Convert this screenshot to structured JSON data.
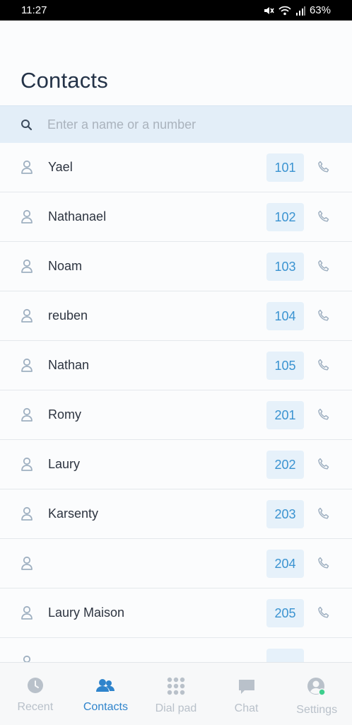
{
  "status_bar": {
    "time": "11:27",
    "battery": "63%"
  },
  "page_title": "Contacts",
  "search": {
    "placeholder": "Enter a name or a number",
    "value": ""
  },
  "contacts": [
    {
      "name": "Yael",
      "ext": "101"
    },
    {
      "name": "Nathanael",
      "ext": "102"
    },
    {
      "name": "Noam",
      "ext": "103"
    },
    {
      "name": "reuben",
      "ext": "104"
    },
    {
      "name": "Nathan",
      "ext": "105"
    },
    {
      "name": "Romy",
      "ext": "201"
    },
    {
      "name": "Laury",
      "ext": "202"
    },
    {
      "name": "Karsenty",
      "ext": "203"
    },
    {
      "name": "",
      "ext": "204"
    },
    {
      "name": "Laury Maison",
      "ext": "205"
    }
  ],
  "tabs": [
    {
      "label": "Recent",
      "icon": "clock-icon",
      "active": false
    },
    {
      "label": "Contacts",
      "icon": "contacts-icon",
      "active": true
    },
    {
      "label": "Dial pad",
      "icon": "dialpad-icon",
      "active": false
    },
    {
      "label": "Chat",
      "icon": "chat-icon",
      "active": false
    },
    {
      "label": "Settings",
      "icon": "settings-avatar-icon",
      "active": false
    }
  ],
  "colors": {
    "accent": "#2f84cc",
    "ext_bg": "#e6f1fa",
    "search_bg": "#e3eef8",
    "online": "#3ecf8e"
  }
}
